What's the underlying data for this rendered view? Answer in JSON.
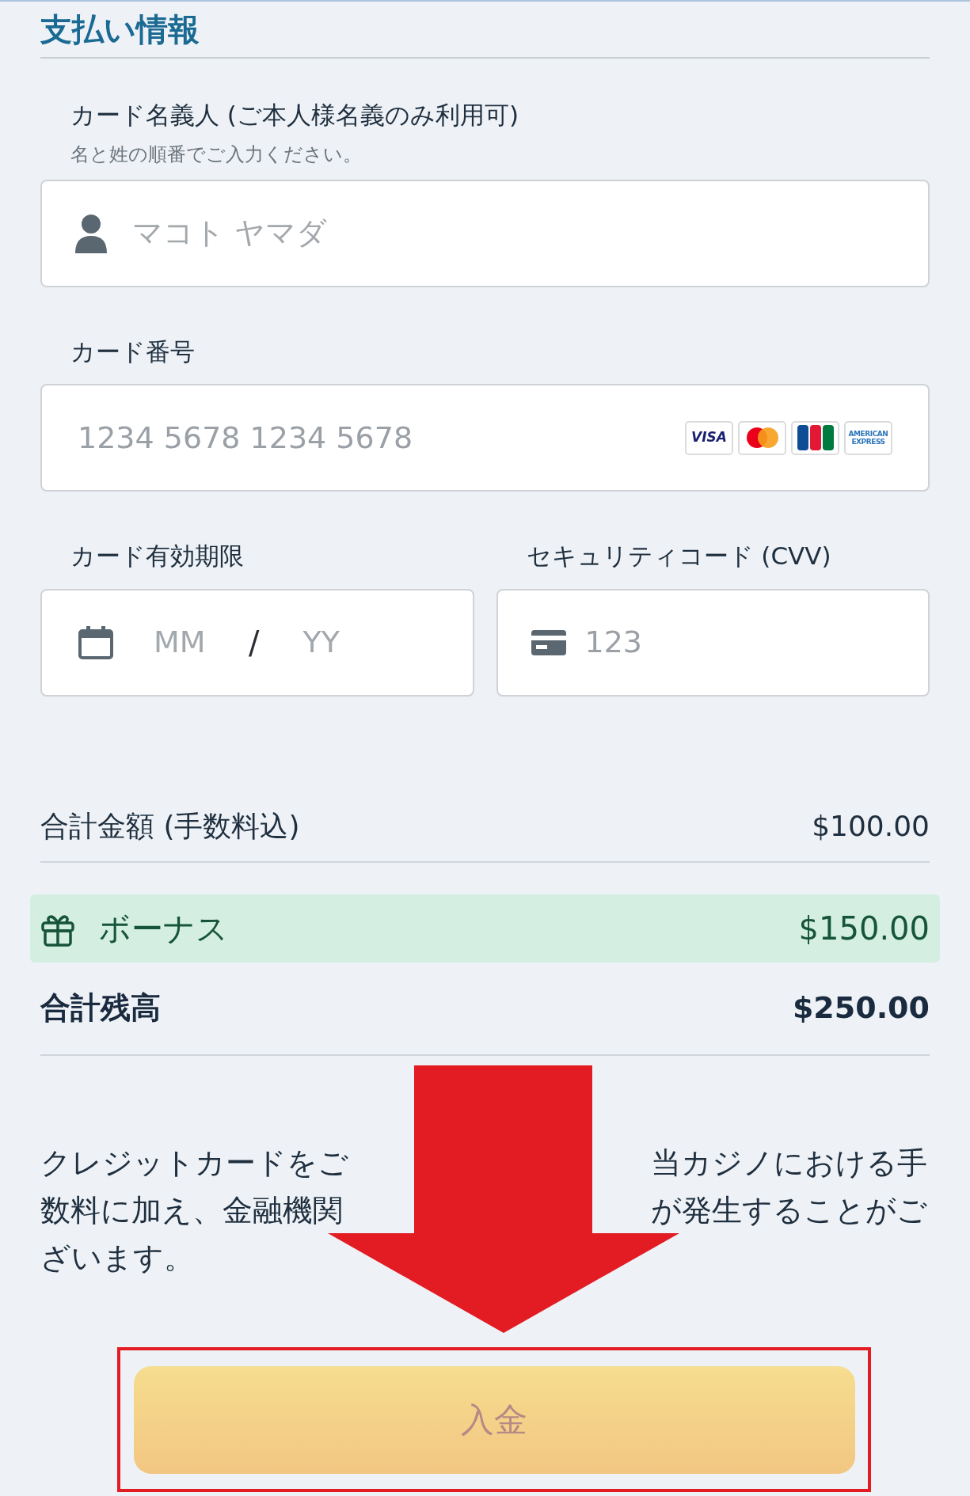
{
  "title": "支払い情報",
  "holder": {
    "label": "カード名義人 (ご本人様名義のみ利用可)",
    "hint": "名と姓の順番でご入力ください。",
    "placeholder": "マコト ヤマダ"
  },
  "card_number": {
    "label": "カード番号",
    "placeholder": "1234 5678 1234 5678",
    "brands": [
      {
        "kind": "visa",
        "label": "VISA"
      },
      {
        "kind": "mastercard"
      },
      {
        "kind": "jcb"
      },
      {
        "kind": "amex",
        "label": "AMERICAN EXPRESS"
      }
    ]
  },
  "expiry": {
    "label": "カード有効期限",
    "month_placeholder": "MM",
    "separator": "/",
    "year_placeholder": "YY"
  },
  "cvv": {
    "label": "セキュリティコード (CVV)",
    "placeholder": "123"
  },
  "summary": [
    {
      "kind": "total",
      "label": "合計金額 (手数料込)",
      "value": "$100.00"
    },
    {
      "kind": "bonus",
      "label": "ボーナス",
      "value": "$150.00"
    },
    {
      "kind": "balance",
      "label": "合計残高",
      "value": "$250.00"
    }
  ],
  "notice_lines": [
    {
      "left": "クレジットカードをご",
      "right": "当カジノにおける手"
    },
    {
      "left": "数料に加え、金融機関",
      "right": "が発生することがご"
    },
    {
      "left": "ざいます。"
    }
  ],
  "submit": {
    "label": "入金"
  }
}
